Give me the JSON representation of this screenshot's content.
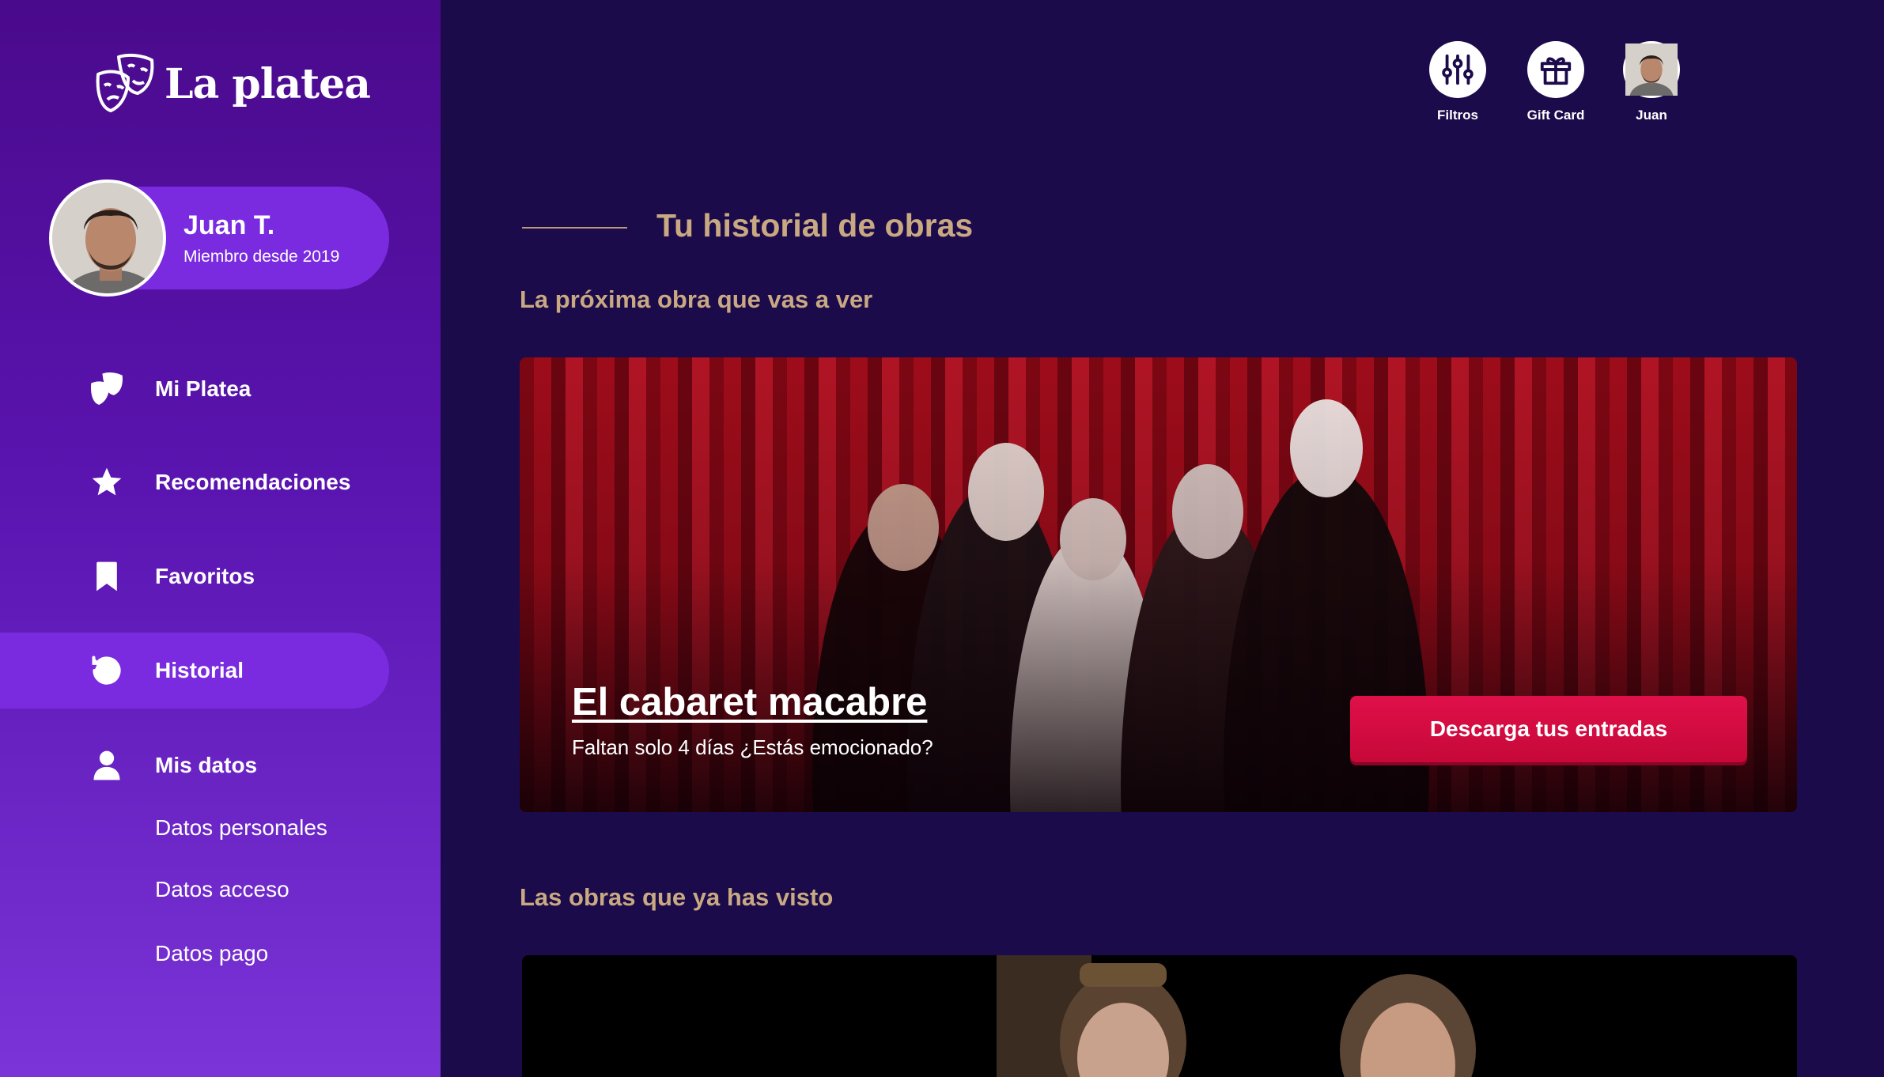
{
  "brand": {
    "name": "La platea"
  },
  "profile": {
    "name": "Juan T.",
    "since": "Miembro desde 2019"
  },
  "nav": {
    "items": [
      {
        "label": "Mi Platea",
        "icon": "theater-masks-icon"
      },
      {
        "label": "Recomendaciones",
        "icon": "star-icon"
      },
      {
        "label": "Favoritos",
        "icon": "bookmark-icon"
      },
      {
        "label": "Historial",
        "icon": "history-icon",
        "active": true
      },
      {
        "label": "Mis datos",
        "icon": "user-icon"
      }
    ],
    "sub_items": [
      "Datos personales",
      "Datos acceso",
      "Datos pago"
    ]
  },
  "topbar": {
    "filters_label": "Filtros",
    "gift_label": "Gift Card",
    "user_label": "Juan"
  },
  "main": {
    "title": "Tu historial de obras",
    "next_section": "La próxima obra que vas a ver",
    "seen_section": "Las obras que ya has visto"
  },
  "hero": {
    "title": "El cabaret macabre",
    "subtitle": "Faltan solo 4 días ¿Estás emocionado?",
    "button": "Descarga tus entradas"
  },
  "colors": {
    "accent": "#7a2be0",
    "gold": "#c9a982",
    "button": "#d80c42",
    "background": "#1c0b4b"
  }
}
